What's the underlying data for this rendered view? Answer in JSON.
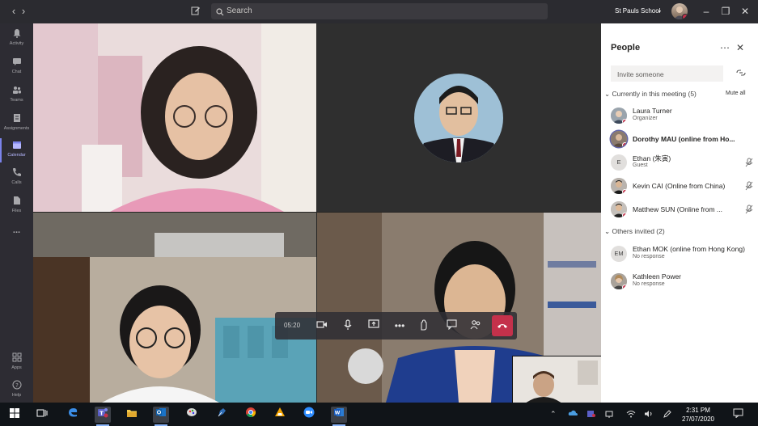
{
  "titlebar": {
    "search_placeholder": "Search",
    "org_name": "St Pauls School",
    "org_chevron": "⌄",
    "back_icon": "chevron-left",
    "forward_icon": "chevron-right",
    "compose_icon": "compose"
  },
  "rail": [
    {
      "label": "Activity",
      "icon": "bell"
    },
    {
      "label": "Chat",
      "icon": "chat"
    },
    {
      "label": "Teams",
      "icon": "teams"
    },
    {
      "label": "Assignments",
      "icon": "assignments"
    },
    {
      "label": "Calendar",
      "icon": "calendar",
      "active": true
    },
    {
      "label": "Calls",
      "icon": "phone"
    },
    {
      "label": "Files",
      "icon": "file"
    },
    {
      "label": "...",
      "icon": "more"
    },
    {
      "label": "Apps",
      "icon": "apps"
    },
    {
      "label": "Help",
      "icon": "help"
    }
  ],
  "callbar": {
    "timer": "05:20"
  },
  "panel": {
    "title": "People",
    "invite_placeholder": "Invite someone",
    "in_meeting_header": "Currently in this meeting (5)",
    "mute_all": "Mute all",
    "participants": [
      {
        "name": "Laura Turner",
        "role": "Organizer",
        "bold": false,
        "initials": "",
        "muted": false
      },
      {
        "name": "Dorothy MAU (online from Ho...",
        "role": "",
        "bold": true,
        "initials": "",
        "muted": false
      },
      {
        "name": "Ethan (朱寅)",
        "role": "Guest",
        "bold": false,
        "initials": "E",
        "muted": true
      },
      {
        "name": "Kevin CAI (Online from China)",
        "role": "",
        "bold": false,
        "initials": "",
        "muted": true
      },
      {
        "name": "Matthew SUN (Online from ...",
        "role": "",
        "bold": false,
        "initials": "",
        "muted": true
      }
    ],
    "others_header": "Others invited (2)",
    "invited": [
      {
        "name": "Ethan MOK (online from Hong Kong)",
        "role": "No response",
        "initials": "EM"
      },
      {
        "name": "Kathleen Power",
        "role": "No response",
        "initials": ""
      }
    ]
  },
  "taskbar": {
    "time": "2:31 PM",
    "date": "27/07/2020"
  },
  "colors": {
    "accent": "#7b83eb",
    "hangup": "#c4314b",
    "titlebar": "#2b2b30",
    "rail": "#2d2c33"
  }
}
